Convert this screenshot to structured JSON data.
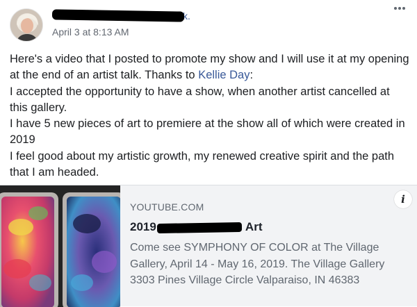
{
  "author": {
    "name_visible_suffix": "k.",
    "timestamp": "April 3 at 8:13 AM"
  },
  "post": {
    "line1_before_mention": "Here's a video that I posted to promote my show and I will use it at my opening at the end of an artist talk. Thanks to ",
    "mention": "Kellie Day",
    "line1_after_mention": ":",
    "line2": "I accepted the opportunity to have a show, when another artist cancelled at this gallery.",
    "line3": "I have 5 new pieces of art to premiere at the show all of which were created in 2019",
    "line4": "I feel good about my artistic growth, my renewed creative spirit and the path that I am headed."
  },
  "link_card": {
    "domain": "YOUTUBE.COM",
    "title_start": "2019",
    "title_end": "Art",
    "description": "Come see SYMPHONY OF COLOR at The Village Gallery, April 14 - May 16, 2019. The Village Gallery 3303 Pines Village Circle Valparaiso, IN 46383",
    "info_icon": "i"
  },
  "icons": {
    "more": "more-options-icon",
    "info": "info-icon"
  }
}
